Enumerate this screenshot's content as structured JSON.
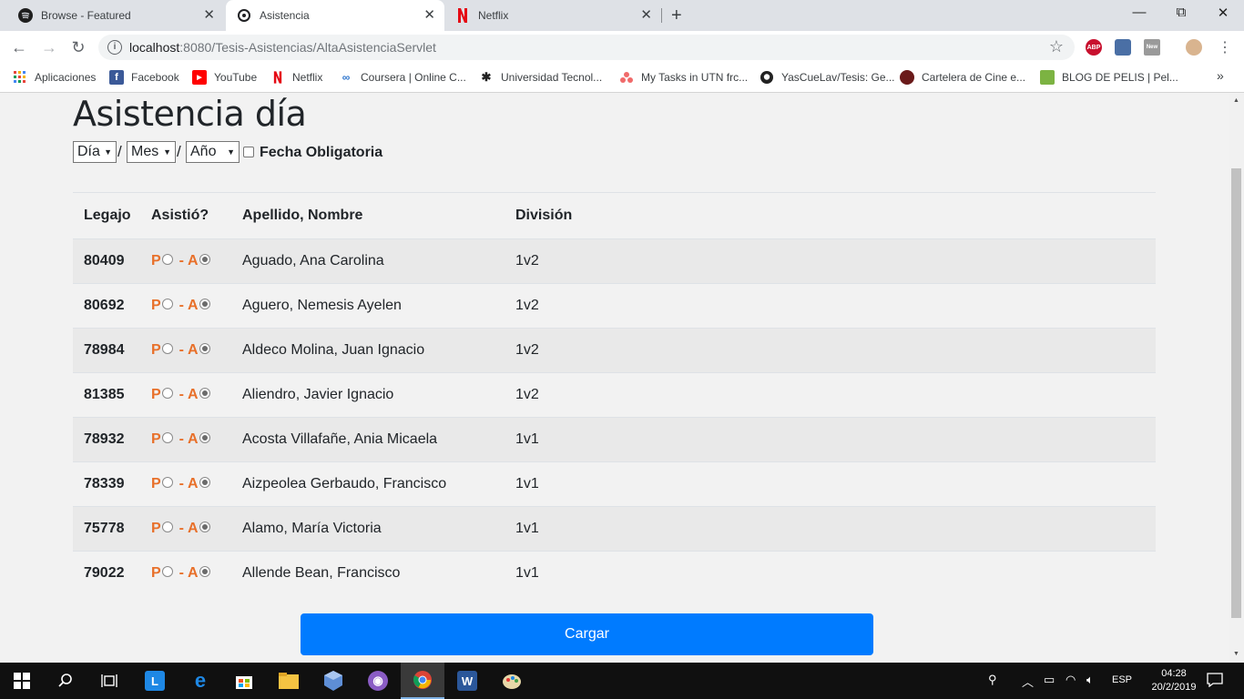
{
  "browser": {
    "tabs": [
      {
        "title": "Browse - Featured",
        "icon": "spotify-icon"
      },
      {
        "title": "Asistencia",
        "icon": "page-icon"
      },
      {
        "title": "Netflix",
        "icon": "netflix-icon"
      }
    ],
    "url_host": "localhost",
    "url_rest": ":8080/Tesis-Asistencias/AltaAsistenciaServlet",
    "bookmarks": [
      {
        "label": "Aplicaciones",
        "icon": "apps-grid-icon"
      },
      {
        "label": "Facebook",
        "icon": "facebook-icon"
      },
      {
        "label": "YouTube",
        "icon": "youtube-icon"
      },
      {
        "label": "Netflix",
        "icon": "netflix-icon"
      },
      {
        "label": "Coursera | Online C...",
        "icon": "coursera-icon"
      },
      {
        "label": "Universidad Tecnol...",
        "icon": "utn-icon"
      },
      {
        "label": "My Tasks in UTN frc...",
        "icon": "asana-icon"
      },
      {
        "label": "YasCueLav/Tesis: Ge...",
        "icon": "github-icon"
      },
      {
        "label": "Cartelera de Cine e...",
        "icon": "cinema-icon"
      },
      {
        "label": "BLOG DE PELIS | Pel...",
        "icon": "blog-icon"
      }
    ],
    "extensions": {
      "abp": "ABP",
      "new": "New"
    }
  },
  "page": {
    "title": "Asistencia día",
    "date": {
      "day": "Día",
      "month": "Mes",
      "year": "Año",
      "slash": "/"
    },
    "fecha_label": "Fecha Obligatoria",
    "columns": [
      "Legajo",
      "Asistió?",
      "Apellido, Nombre",
      "División"
    ],
    "att": {
      "p": "P",
      "dash": "-",
      "a": "A"
    },
    "rows": [
      {
        "legajo": "80409",
        "nombre": "Aguado, Ana Carolina",
        "division": "1v2"
      },
      {
        "legajo": "80692",
        "nombre": "Aguero, Nemesis Ayelen",
        "division": "1v2"
      },
      {
        "legajo": "78984",
        "nombre": "Aldeco Molina, Juan Ignacio",
        "division": "1v2"
      },
      {
        "legajo": "81385",
        "nombre": "Aliendro, Javier Ignacio",
        "division": "1v2"
      },
      {
        "legajo": "78932",
        "nombre": "Acosta Villafañe, Ania Micaela",
        "division": "1v1"
      },
      {
        "legajo": "78339",
        "nombre": "Aizpeolea Gerbaudo, Francisco",
        "division": "1v1"
      },
      {
        "legajo": "75778",
        "nombre": "Alamo, María Victoria",
        "division": "1v1"
      },
      {
        "legajo": "79022",
        "nombre": "Allende Bean, Francisco",
        "division": "1v1"
      }
    ],
    "submit_label": "Cargar"
  },
  "taskbar": {
    "lang": "ESP",
    "time": "04:28",
    "date": "20/2/2019"
  },
  "colors": {
    "accent": "#007bff",
    "attendance": "#e8702a"
  }
}
